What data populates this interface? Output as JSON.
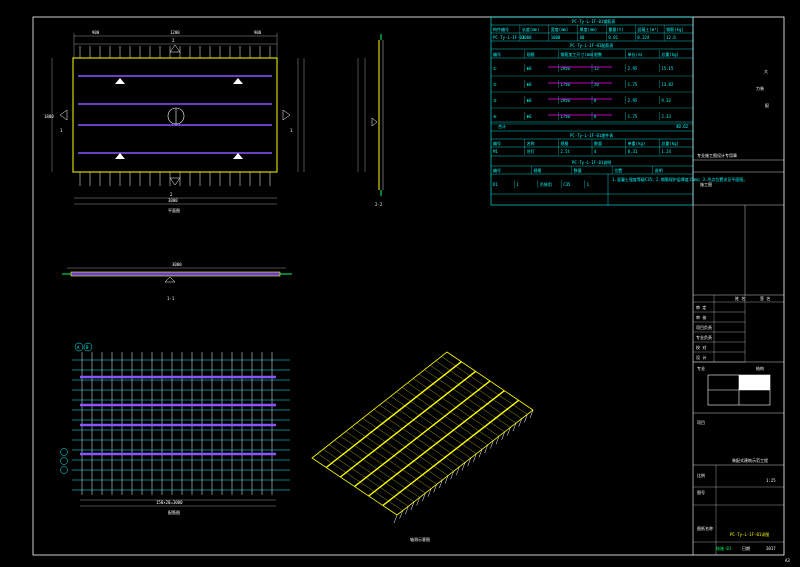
{
  "drawing": {
    "views": {
      "plan_label": "平面图",
      "section_a_label": "2-2",
      "section_b_label": "1-1",
      "rebar_label": "配筋图",
      "iso_label": "轴测示意图"
    },
    "dims": {
      "plan_top_left": "900",
      "plan_top_mid": "1200",
      "plan_top_right": "900",
      "plan_bottom": "3000",
      "plan_side": "1800",
      "section_len": "3000",
      "rebar_bottom": "150×20=3000"
    },
    "axis_marks": {
      "a": "2",
      "b": "1",
      "c": "A",
      "d": "B"
    },
    "table": {
      "title1": "PC-Ty-L-1F-01钢筋表",
      "h1": [
        "构件编号",
        "长度(mm)",
        "宽度(mm)",
        "厚度(mm)",
        "重量(t)",
        "混凝土(m³)",
        "钢筋(kg)"
      ],
      "r1": [
        "PC-Ty-L-1F-01",
        "3000",
        "1800",
        "60",
        "0.81",
        "0.324",
        "12.6"
      ],
      "title2": "PC-Ty-L-1F-01配筋表",
      "h2": [
        "编号",
        "规格",
        "钢筋加工尺寸(mm)",
        "根数",
        "单长(m)",
        "总重(kg)"
      ],
      "r2": [
        [
          "①",
          "Φ8",
          "2950",
          "13",
          "2.95",
          "15.15"
        ],
        [
          "②",
          "Φ8",
          "1750",
          "20",
          "1.75",
          "13.82"
        ],
        [
          "③",
          "Φ8",
          "2950",
          "8",
          "2.95",
          "9.32"
        ],
        [
          "④",
          "Φ6",
          "1750",
          "6",
          "1.75",
          "2.33"
        ]
      ],
      "total_label": "合计",
      "total_value": "40.62",
      "title3": "PC-Ty-L-1F-01埋件表",
      "h3": [
        "编号",
        "名称",
        "规格",
        "数量",
        "单重(kg)",
        "总重(kg)"
      ],
      "r3": [
        "M1",
        "吊钉",
        "2.5t",
        "4",
        "0.31",
        "1.24"
      ],
      "title4": "PC-Ty-L-1F-01说明",
      "h4": [
        "编号",
        "规格",
        "数量",
        "位置",
        "说明"
      ],
      "r4": [
        "D1",
        "1",
        "吊装用",
        "C35",
        "1"
      ],
      "note": "1.混凝土强度等级C35；2.钢筋保护层厚度15mm；3.吊点位置详见平面图。"
    },
    "title_block": {
      "company_a": "大",
      "company_b": "力装",
      "company_c": "配",
      "seal_line": "专业施工图设计专用章",
      "stage": "施工图",
      "row_labels": [
        "审 定",
        "审 核",
        "项目负责",
        "专业负责",
        "校 对",
        "设 计"
      ],
      "col_labels": [
        "姓 名",
        "签 名"
      ],
      "project_label": "项目",
      "project_value": "装配式建筑示范工程",
      "scale_label": "比例",
      "scale_value": "1:25",
      "sheet_label": "图纸名称",
      "sheet_title": "PC-Ty-L-1F-01详图",
      "drawing_no_label": "图号",
      "drawing_no": "结施-01",
      "date_label": "日期",
      "date_value": "2017",
      "corner_note": "A3",
      "subject_label": "专业",
      "subject_value": "结构"
    }
  }
}
